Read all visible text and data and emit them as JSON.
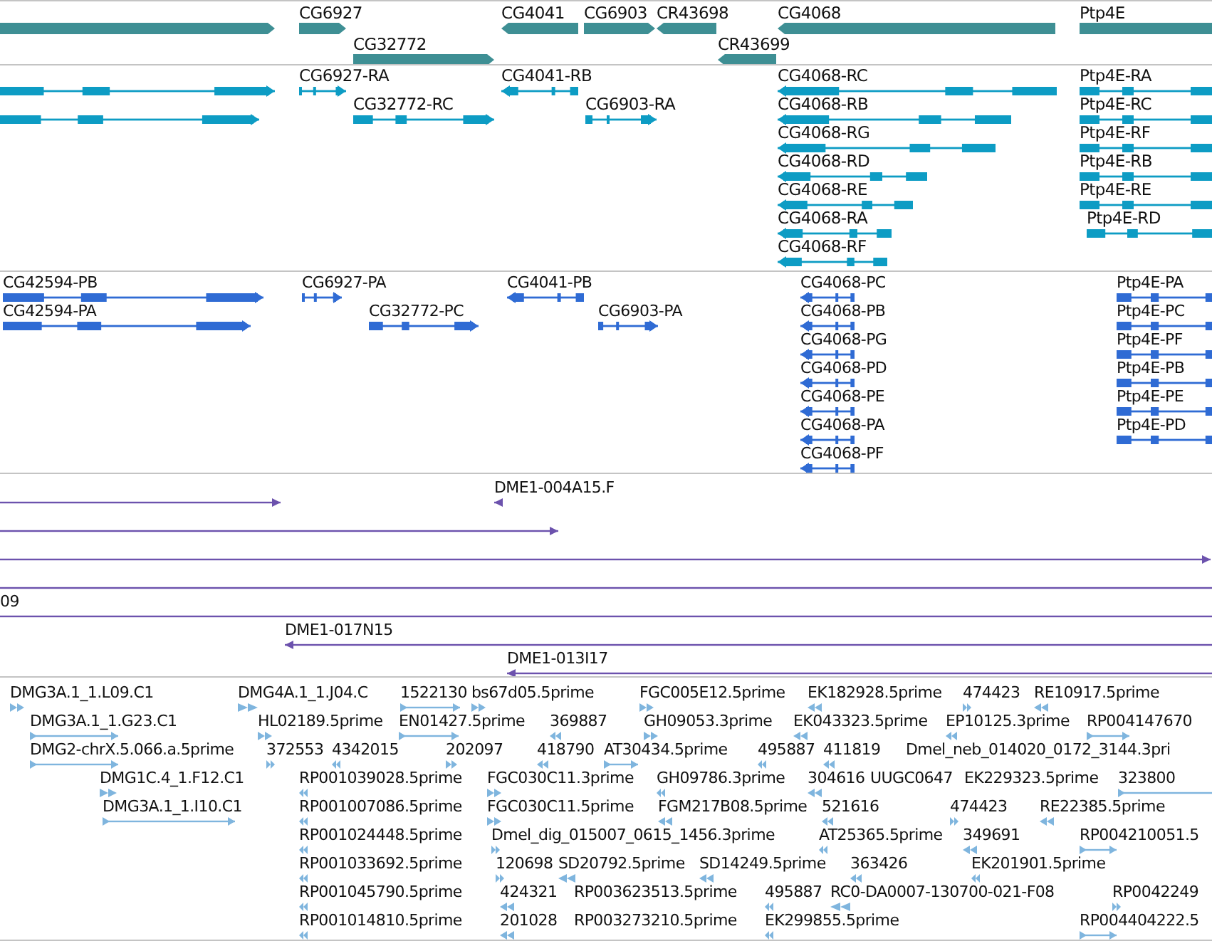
{
  "tracks": [
    {
      "kind": "genes",
      "features": [
        {
          "reverse": false
        },
        {
          "label": "CG6927",
          "reverse": false
        },
        {
          "label": "CG32772",
          "reverse": false
        },
        {
          "label": "CG4041",
          "reverse": true
        },
        {
          "label": "CG6903",
          "reverse": false
        },
        {
          "label": "CR43698",
          "reverse": true
        },
        {
          "label": "CR43699",
          "reverse": true
        },
        {
          "label": "CG4068",
          "reverse": true
        },
        {
          "label": "Ptp4E",
          "reverse": false
        }
      ]
    },
    {
      "kind": "transcripts",
      "features": [
        {
          "reverse": false
        },
        {
          "reverse": false
        },
        {
          "label": "CG6927-RA",
          "reverse": false
        },
        {
          "label": "CG32772-RC",
          "reverse": false
        },
        {
          "label": "CG4041-RB",
          "reverse": true
        },
        {
          "label": "CG6903-RA",
          "reverse": false
        },
        {
          "label": "CG4068-RC",
          "reverse": true
        },
        {
          "label": "CG4068-RB",
          "reverse": true
        },
        {
          "label": "CG4068-RG",
          "reverse": true
        },
        {
          "label": "CG4068-RD",
          "reverse": true
        },
        {
          "label": "CG4068-RE",
          "reverse": true
        },
        {
          "label": "CG4068-RA",
          "reverse": true
        },
        {
          "label": "CG4068-RF",
          "reverse": true
        },
        {
          "label": "Ptp4E-RA",
          "reverse": false
        },
        {
          "label": "Ptp4E-RC",
          "reverse": false
        },
        {
          "label": "Ptp4E-RF",
          "reverse": false
        },
        {
          "label": "Ptp4E-RB",
          "reverse": false
        },
        {
          "label": "Ptp4E-RE",
          "reverse": false
        },
        {
          "label": "Ptp4E-RD",
          "reverse": false
        }
      ]
    },
    {
      "kind": "proteins",
      "features": [
        {
          "label": "CG42594-PB",
          "reverse": false
        },
        {
          "label": "CG42594-PA",
          "reverse": false
        },
        {
          "label": "CG6927-PA",
          "reverse": false
        },
        {
          "label": "CG32772-PC",
          "reverse": false
        },
        {
          "label": "CG4041-PB",
          "reverse": true
        },
        {
          "label": "CG6903-PA",
          "reverse": false
        },
        {
          "label": "CG4068-PC",
          "reverse": true
        },
        {
          "label": "CG4068-PB",
          "reverse": true
        },
        {
          "label": "CG4068-PG",
          "reverse": true
        },
        {
          "label": "CG4068-PD",
          "reverse": true
        },
        {
          "label": "CG4068-PE",
          "reverse": true
        },
        {
          "label": "CG4068-PA",
          "reverse": true
        },
        {
          "label": "CG4068-PF",
          "reverse": true
        },
        {
          "label": "Ptp4E-PA",
          "reverse": false
        },
        {
          "label": "Ptp4E-PC",
          "reverse": false
        },
        {
          "label": "Ptp4E-PF",
          "reverse": false
        },
        {
          "label": "Ptp4E-PB",
          "reverse": false
        },
        {
          "label": "Ptp4E-PE",
          "reverse": false
        },
        {
          "label": "Ptp4E-PD",
          "reverse": false
        }
      ]
    },
    {
      "kind": "clones",
      "features": [
        {
          "reverse": false
        },
        {
          "label": "DME1-004A15.F",
          "reverse": true
        },
        {
          "reverse": false
        },
        {
          "reverse": false
        },
        {
          "reverse": false
        },
        {
          "label": "09",
          "reverse": false
        },
        {
          "label": "DME1-017N15",
          "reverse": true
        },
        {
          "label": "DME1-013I17",
          "reverse": true
        }
      ]
    },
    {
      "kind": "ests",
      "features": [
        {
          "label": "DMG3A.1_1.L09.C1",
          "reverse": false
        },
        {
          "label": "DMG4A.1_1.J04.C",
          "reverse": false
        },
        {
          "label": "1522130",
          "reverse": false
        },
        {
          "label": "bs67d05.5prime",
          "reverse": false
        },
        {
          "label": "FGC005E12.5prime",
          "reverse": false
        },
        {
          "label": "EK182928.5prime",
          "reverse": true
        },
        {
          "label": "474423",
          "reverse": false
        },
        {
          "label": "RE10917.5prime",
          "reverse": true
        },
        {
          "label": "DMG3A.1_1.G23.C1",
          "reverse": false
        },
        {
          "label": "HL02189.5prime",
          "reverse": false
        },
        {
          "label": "EN01427.5prime",
          "reverse": false
        },
        {
          "label": "369887",
          "reverse": true
        },
        {
          "label": "GH09053.3prime",
          "reverse": false
        },
        {
          "label": "EK043323.5prime",
          "reverse": true
        },
        {
          "label": "EP10125.3prime",
          "reverse": true
        },
        {
          "label": "RP004147670",
          "reverse": false
        },
        {
          "label": "DMG2-chrX.5.066.a.5prime",
          "reverse": false
        },
        {
          "label": "372553",
          "reverse": false
        },
        {
          "label": "4342015",
          "reverse": true
        },
        {
          "label": "202097",
          "reverse": false
        },
        {
          "label": "418790",
          "reverse": true
        },
        {
          "label": "AT30434.5prime",
          "reverse": false
        },
        {
          "label": "495887",
          "reverse": true
        },
        {
          "label": "411819",
          "reverse": true
        },
        {
          "label": "Dmel_neb_014020_0172_3144.3pri"
        },
        {
          "label": "DMG1C.4_1.F12.C1",
          "reverse": false
        },
        {
          "label": "RP001039028.5prime",
          "reverse": true
        },
        {
          "label": "FGC030C11.3prime",
          "reverse": false
        },
        {
          "label": "GH09786.3prime",
          "reverse": true
        },
        {
          "label": "304616",
          "reverse": true
        },
        {
          "label": "UUGC0647"
        },
        {
          "label": "EK229323.5prime"
        },
        {
          "label": "323800",
          "reverse": false
        },
        {
          "label": "DMG3A.1_1.I10.C1",
          "reverse": false
        },
        {
          "label": "RP001007086.5prime",
          "reverse": true
        },
        {
          "label": "FGC030C11.5prime",
          "reverse": false
        },
        {
          "label": "FGM217B08.5prime",
          "reverse": true
        },
        {
          "label": "521616",
          "reverse": true
        },
        {
          "label": "474423",
          "reverse": false
        },
        {
          "label": "RE22385.5prime",
          "reverse": true
        },
        {
          "label": "RP001024448.5prime",
          "reverse": true
        },
        {
          "label": "Dmel_dig_015007_0615_1456.3prime",
          "reverse": false
        },
        {
          "label": "AT25365.5prime",
          "reverse": true
        },
        {
          "label": "349691",
          "reverse": true
        },
        {
          "label": "RP004210051.5",
          "reverse": false
        },
        {
          "label": "RP001033692.5prime",
          "reverse": true
        },
        {
          "label": "120698",
          "reverse": false
        },
        {
          "label": "SD20792.5prime",
          "reverse": true
        },
        {
          "label": "SD14249.5prime",
          "reverse": true
        },
        {
          "label": "363426",
          "reverse": true
        },
        {
          "label": "EK201901.5prime",
          "reverse": true
        },
        {
          "label": "RP001045790.5prime",
          "reverse": true
        },
        {
          "label": "424321",
          "reverse": true
        },
        {
          "label": "RP003623513.5prime"
        },
        {
          "label": "495887",
          "reverse": true
        },
        {
          "label": "RC0-DA0007-130700-021-F08",
          "reverse": true
        },
        {
          "label": "RP0042249",
          "reverse": false
        },
        {
          "label": "RP001014810.5prime",
          "reverse": true
        },
        {
          "label": "201028",
          "reverse": true
        },
        {
          "label": "RP003273210.5prime"
        },
        {
          "label": "EK299855.5prime",
          "reverse": true
        },
        {
          "label": "RP004404222.5",
          "reverse": false
        }
      ]
    }
  ]
}
